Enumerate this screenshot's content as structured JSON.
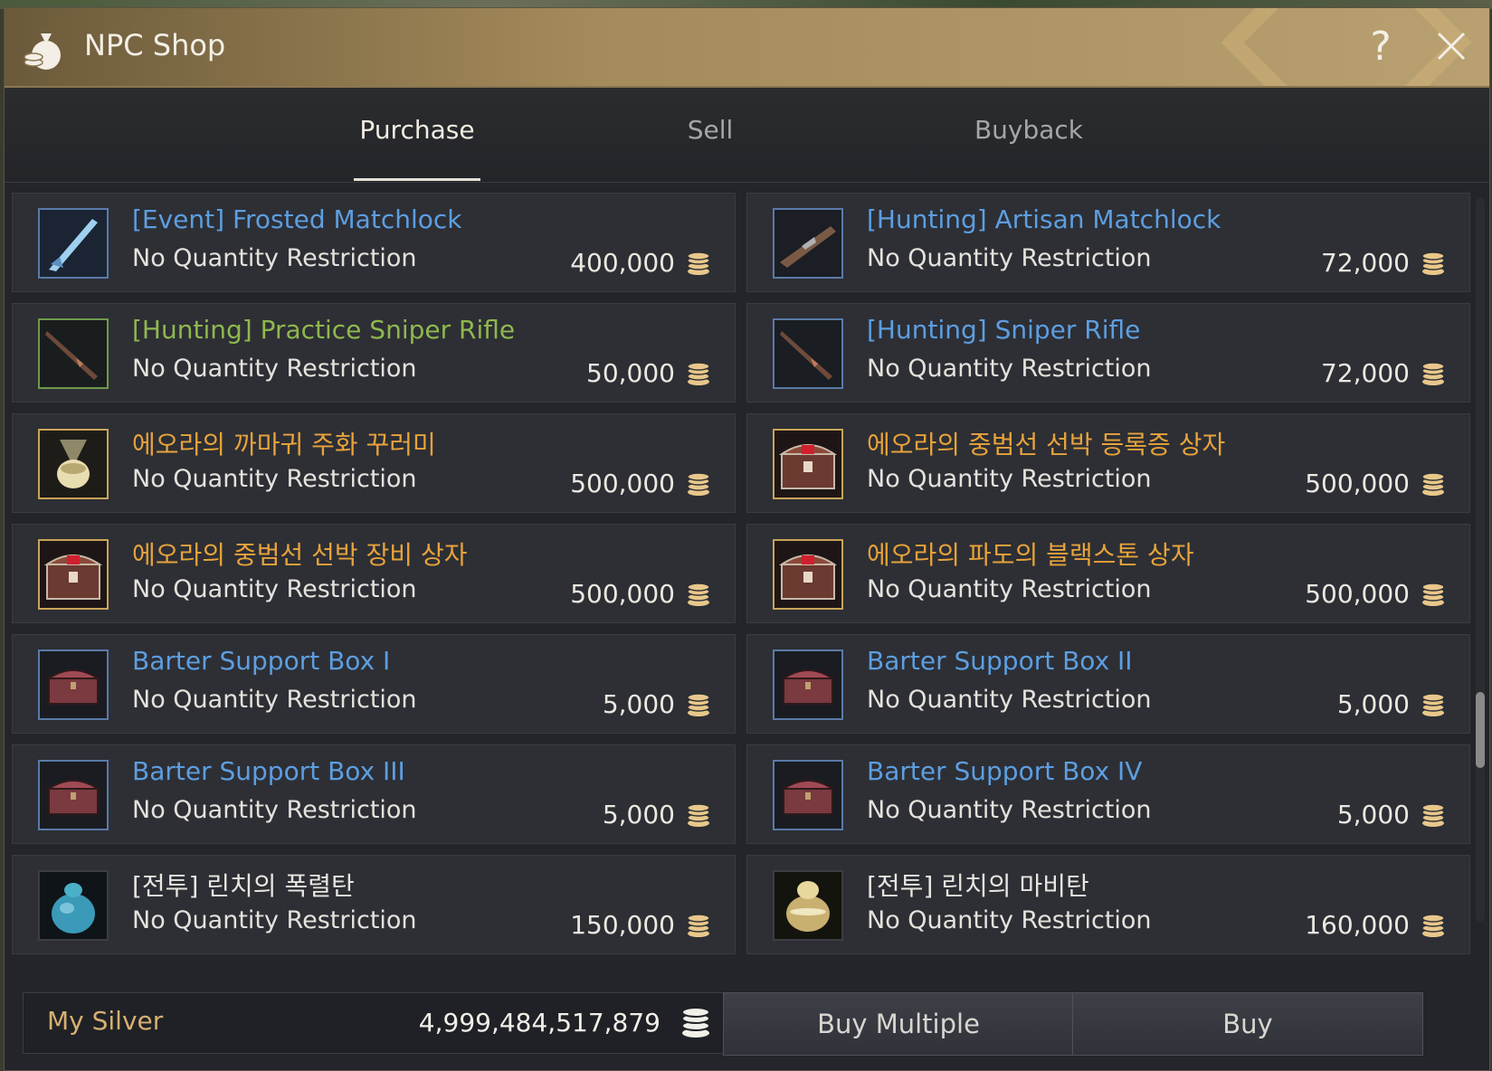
{
  "window": {
    "title": "NPC Shop",
    "help": "?"
  },
  "tabs": [
    "Purchase",
    "Sell",
    "Buyback"
  ],
  "items": [
    {
      "name": "[Event] Frosted Matchlock",
      "restriction": "No Quantity Restriction",
      "price": "400,000",
      "color": "blue",
      "icon": "frosted-matchlock-icon"
    },
    {
      "name": "[Hunting] Artisan Matchlock",
      "restriction": "No Quantity Restriction",
      "price": "72,000",
      "color": "blue",
      "icon": "artisan-matchlock-icon"
    },
    {
      "name": "[Hunting] Practice Sniper Rifle",
      "restriction": "No Quantity Restriction",
      "price": "50,000",
      "color": "green",
      "icon": "practice-sniper-rifle-icon"
    },
    {
      "name": "[Hunting] Sniper Rifle",
      "restriction": "No Quantity Restriction",
      "price": "72,000",
      "color": "blue",
      "icon": "sniper-rifle-icon"
    },
    {
      "name": "에오라의 까마귀 주화 꾸러미",
      "restriction": "No Quantity Restriction",
      "price": "500,000",
      "color": "orange",
      "icon": "coin-pouch-icon"
    },
    {
      "name": "에오라의 중범선 선박 등록증 상자",
      "restriction": "No Quantity Restriction",
      "price": "500,000",
      "color": "orange",
      "icon": "treasure-chest-icon"
    },
    {
      "name": "에오라의 중범선 선박 장비 상자",
      "restriction": "No Quantity Restriction",
      "price": "500,000",
      "color": "orange",
      "icon": "treasure-chest-icon"
    },
    {
      "name": "에오라의 파도의 블랙스톤 상자",
      "restriction": "No Quantity Restriction",
      "price": "500,000",
      "color": "orange",
      "icon": "treasure-chest-icon"
    },
    {
      "name": "Barter Support Box I",
      "restriction": "No Quantity Restriction",
      "price": "5,000",
      "color": "blue",
      "icon": "barter-box-icon"
    },
    {
      "name": "Barter Support Box II",
      "restriction": "No Quantity Restriction",
      "price": "5,000",
      "color": "blue",
      "icon": "barter-box-icon"
    },
    {
      "name": "Barter Support Box III",
      "restriction": "No Quantity Restriction",
      "price": "5,000",
      "color": "blue",
      "icon": "barter-box-icon"
    },
    {
      "name": "Barter Support Box IV",
      "restriction": "No Quantity Restriction",
      "price": "5,000",
      "color": "blue",
      "icon": "barter-box-icon"
    },
    {
      "name": "[전투] 린치의 폭렬탄",
      "restriction": "No Quantity Restriction",
      "price": "150,000",
      "color": "white",
      "icon": "blue-bomb-icon"
    },
    {
      "name": "[전투] 린치의 마비탄",
      "restriction": "No Quantity Restriction",
      "price": "160,000",
      "color": "white",
      "icon": "gold-bomb-icon"
    }
  ],
  "footer": {
    "silver_label": "My Silver",
    "silver_value": "4,999,484,517,879",
    "buy_multiple": "Buy Multiple",
    "buy": "Buy"
  },
  "colors": {
    "accent": "#a58b5b",
    "blue_name": "#5d9ee0",
    "green_name": "#8fb84e",
    "orange_name": "#e8a33a"
  }
}
